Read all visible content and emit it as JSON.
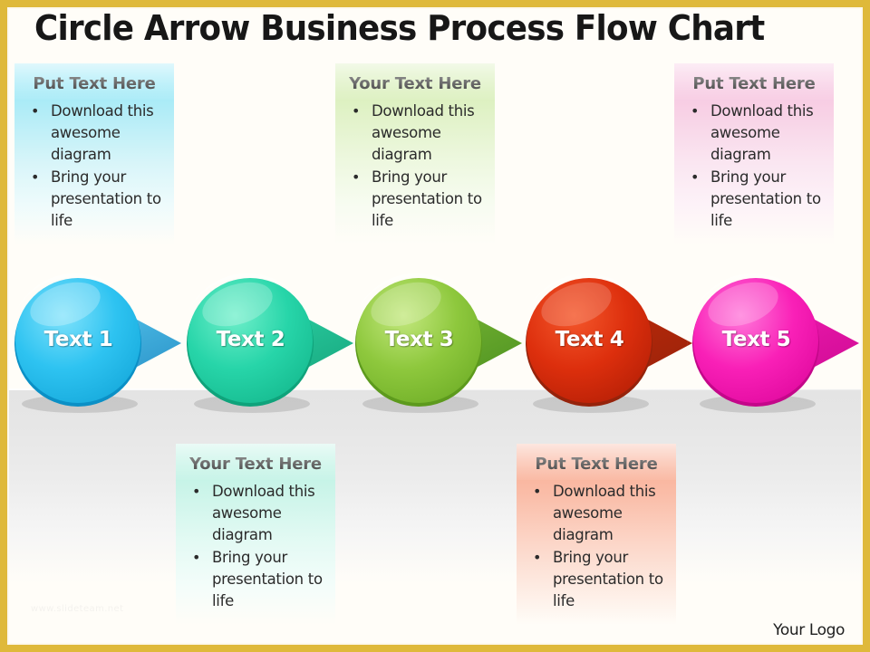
{
  "slide": {
    "title": "Circle Arrow Business Process Flow Chart",
    "footer_logo": "Your Logo",
    "watermark": "www.slideteam.net",
    "frame_color": "#dfb93a",
    "stage_color": "#fffdf8"
  },
  "bullets": {
    "item1": "Download this awesome diagram",
    "item2": "Bring your presentation to life",
    "marker": "•"
  },
  "callouts": [
    {
      "id": "callout-1",
      "position": "top",
      "heading": "Put Text Here",
      "color": "#8fe6f7",
      "swatch_name": "cyan",
      "bullets": [
        "Download this awesome diagram",
        "Bring your presentation to life"
      ]
    },
    {
      "id": "callout-2",
      "position": "bottom",
      "heading": "Your Text Here",
      "color": "#b5f0e0",
      "swatch_name": "mint",
      "bullets": [
        "Download this awesome diagram",
        "Bring your presentation to life"
      ]
    },
    {
      "id": "callout-3",
      "position": "top",
      "heading": "Your Text Here",
      "color": "#d2ecae",
      "swatch_name": "green",
      "bullets": [
        "Download this awesome diagram",
        "Bring your presentation to life"
      ]
    },
    {
      "id": "callout-4",
      "position": "bottom",
      "heading": "Put Text Here",
      "color": "#f8a98f",
      "swatch_name": "salmon",
      "bullets": [
        "Download this awesome diagram",
        "Bring your presentation to life"
      ]
    },
    {
      "id": "callout-5",
      "position": "top",
      "heading": "Put Text Here",
      "color": "#f5bfdd",
      "swatch_name": "pink",
      "bullets": [
        "Download this awesome diagram",
        "Bring your presentation to life"
      ]
    }
  ],
  "process_steps": [
    {
      "id": "step-1",
      "label": "Text 1",
      "fill_light": "#6fdcf9",
      "fill_mid": "#2ec3f1",
      "fill_dark": "#15a8da",
      "rim": "#0b90c6",
      "arrow_light": "#5fd2f5",
      "arrow_dark": "#2b93c9"
    },
    {
      "id": "step-2",
      "label": "Text 2",
      "fill_light": "#5ce8c0",
      "fill_mid": "#27d5a9",
      "fill_dark": "#15b98e",
      "rim": "#0fa37b",
      "arrow_light": "#31dcae",
      "arrow_dark": "#18a87f"
    },
    {
      "id": "step-3",
      "label": "Text 3",
      "fill_light": "#b4df69",
      "fill_mid": "#8ec83d",
      "fill_dark": "#6fae27",
      "rim": "#5d9a1d",
      "arrow_light": "#83bd3a",
      "arrow_dark": "#4f9421"
    },
    {
      "id": "step-4",
      "label": "Text 4",
      "fill_light": "#f04b22",
      "fill_mid": "#dd2f0d",
      "fill_dark": "#b51f06",
      "rim": "#96230b",
      "arrow_light": "#c62a0c",
      "arrow_dark": "#9a2309"
    },
    {
      "id": "step-5",
      "label": "Text 5",
      "fill_light": "#ff68d4",
      "fill_mid": "#f920b7",
      "fill_dark": "#e0099e",
      "rim": "#c4078a",
      "arrow_light": "#f81fb5",
      "arrow_dark": "#cf0b95"
    }
  ]
}
